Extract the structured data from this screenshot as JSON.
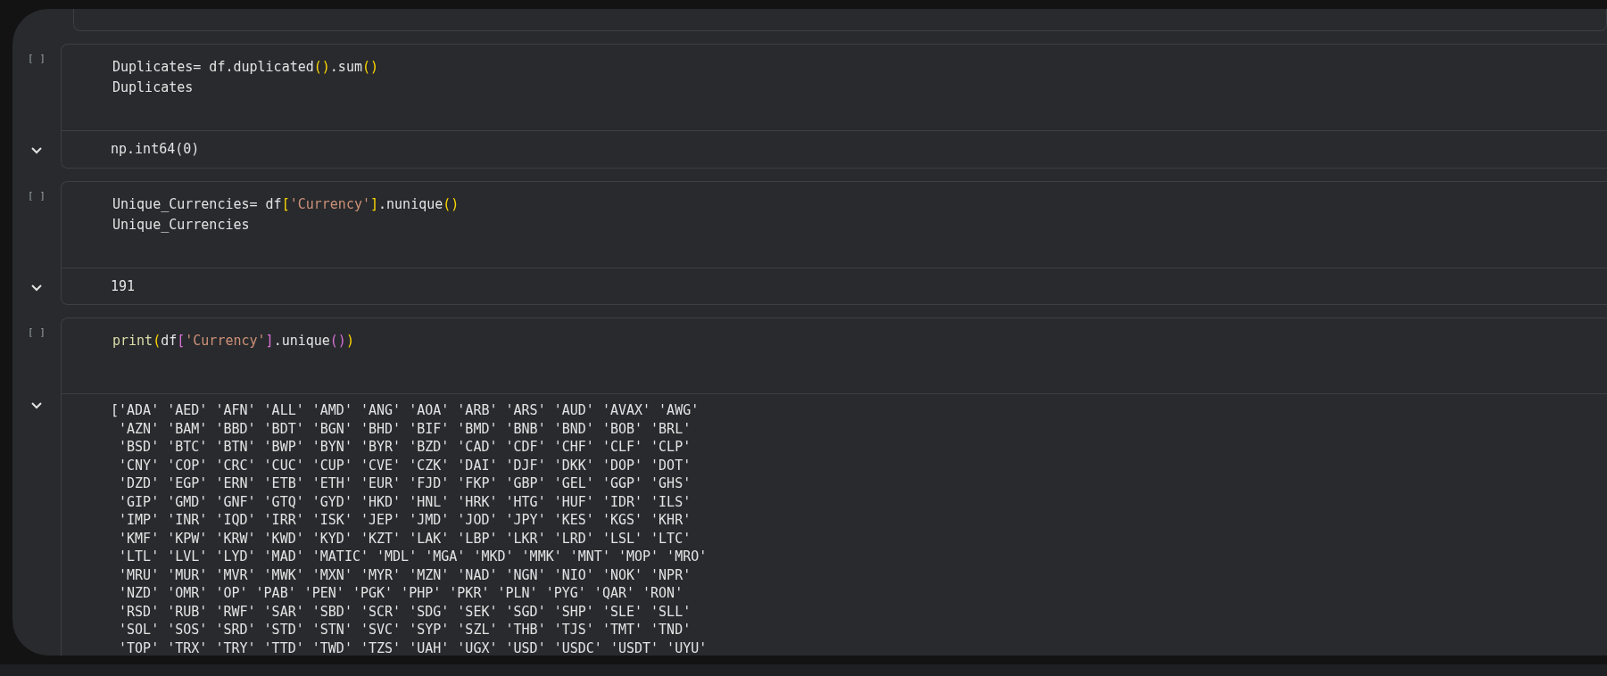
{
  "cells": [
    {
      "run_label": "[ ]",
      "output_expanded": true,
      "code": [
        [
          {
            "text": "Duplicates= df.duplicated",
            "kind": "plain"
          },
          {
            "text": "()",
            "kind": "paren1"
          },
          {
            "text": ".sum",
            "kind": "plain"
          },
          {
            "text": "()",
            "kind": "paren1"
          }
        ],
        [
          {
            "text": "Duplicates",
            "kind": "plain"
          }
        ]
      ],
      "output": [
        "np.int64(0)"
      ]
    },
    {
      "run_label": "[ ]",
      "output_expanded": true,
      "code": [
        [
          {
            "text": "Unique_Currencies= df",
            "kind": "plain"
          },
          {
            "text": "[",
            "kind": "paren1"
          },
          {
            "text": "'Currency'",
            "kind": "string"
          },
          {
            "text": "]",
            "kind": "paren1"
          },
          {
            "text": ".nunique",
            "kind": "plain"
          },
          {
            "text": "()",
            "kind": "paren1"
          }
        ],
        [
          {
            "text": "Unique_Currencies",
            "kind": "plain"
          }
        ]
      ],
      "output": [
        "191"
      ]
    },
    {
      "run_label": "[ ]",
      "output_expanded": true,
      "code": [
        [
          {
            "text": "print",
            "kind": "builtin"
          },
          {
            "text": "(",
            "kind": "paren1"
          },
          {
            "text": "df",
            "kind": "plain"
          },
          {
            "text": "[",
            "kind": "paren2"
          },
          {
            "text": "'Currency'",
            "kind": "string"
          },
          {
            "text": "]",
            "kind": "paren2"
          },
          {
            "text": ".unique",
            "kind": "plain"
          },
          {
            "text": "()",
            "kind": "paren2"
          },
          {
            "text": ")",
            "kind": "paren1"
          }
        ]
      ],
      "output": [
        "['ADA' 'AED' 'AFN' 'ALL' 'AMD' 'ANG' 'AOA' 'ARB' 'ARS' 'AUD' 'AVAX' 'AWG'",
        " 'AZN' 'BAM' 'BBD' 'BDT' 'BGN' 'BHD' 'BIF' 'BMD' 'BNB' 'BND' 'BOB' 'BRL'",
        " 'BSD' 'BTC' 'BTN' 'BWP' 'BYN' 'BYR' 'BZD' 'CAD' 'CDF' 'CHF' 'CLF' 'CLP'",
        " 'CNY' 'COP' 'CRC' 'CUC' 'CUP' 'CVE' 'CZK' 'DAI' 'DJF' 'DKK' 'DOP' 'DOT'",
        " 'DZD' 'EGP' 'ERN' 'ETB' 'ETH' 'EUR' 'FJD' 'FKP' 'GBP' 'GEL' 'GGP' 'GHS'",
        " 'GIP' 'GMD' 'GNF' 'GTQ' 'GYD' 'HKD' 'HNL' 'HRK' 'HTG' 'HUF' 'IDR' 'ILS'",
        " 'IMP' 'INR' 'IQD' 'IRR' 'ISK' 'JEP' 'JMD' 'JOD' 'JPY' 'KES' 'KGS' 'KHR'",
        " 'KMF' 'KPW' 'KRW' 'KWD' 'KYD' 'KZT' 'LAK' 'LBP' 'LKR' 'LRD' 'LSL' 'LTC'",
        " 'LTL' 'LVL' 'LYD' 'MAD' 'MATIC' 'MDL' 'MGA' 'MKD' 'MMK' 'MNT' 'MOP' 'MRO'",
        " 'MRU' 'MUR' 'MVR' 'MWK' 'MXN' 'MYR' 'MZN' 'NAD' 'NGN' 'NIO' 'NOK' 'NPR'",
        " 'NZD' 'OMR' 'OP' 'PAB' 'PEN' 'PGK' 'PHP' 'PKR' 'PLN' 'PYG' 'QAR' 'RON'",
        " 'RSD' 'RUB' 'RWF' 'SAR' 'SBD' 'SCR' 'SDG' 'SEK' 'SGD' 'SHP' 'SLE' 'SLL'",
        " 'SOL' 'SOS' 'SRD' 'STD' 'STN' 'SVC' 'SYP' 'SZL' 'THB' 'TJS' 'TMT' 'TND'",
        " 'TOP' 'TRX' 'TRY' 'TTD' 'TWD' 'TZS' 'UAH' 'UGX' 'USD' 'USDC' 'USDT' 'UYU'"
      ]
    }
  ]
}
